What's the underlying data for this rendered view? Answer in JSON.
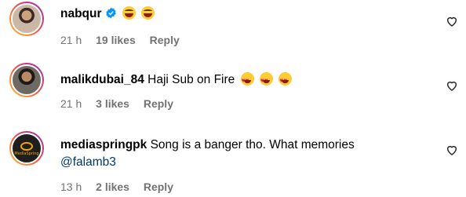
{
  "comments": [
    {
      "username": "nabqur",
      "verified": true,
      "text": "",
      "emojis": [
        "face-with-tears-of-joy",
        "face-with-tears-of-joy"
      ],
      "time": "21 h",
      "likes": "19 likes",
      "reply": "Reply"
    },
    {
      "username": "malikdubai_84",
      "verified": false,
      "text": "Haji Sub on Fire",
      "emojis": [
        "smiling-face-with-heart-eyes",
        "smiling-face-with-heart-eyes",
        "smiling-face-with-heart-eyes"
      ],
      "time": "21 h",
      "likes": "3 likes",
      "reply": "Reply"
    },
    {
      "username": "mediaspringpk",
      "verified": false,
      "text": "Song is a banger tho. What memories",
      "mention": "@falamb3",
      "avatar_text": "MediaSpring",
      "time": "13 h",
      "likes": "2 likes",
      "reply": "Reply"
    }
  ],
  "colors": {
    "meta_text": "#737373",
    "mention": "#00376b",
    "verified_badge": "#0095f6"
  },
  "icons": [
    "verified-badge-icon",
    "heart-outline-icon"
  ]
}
